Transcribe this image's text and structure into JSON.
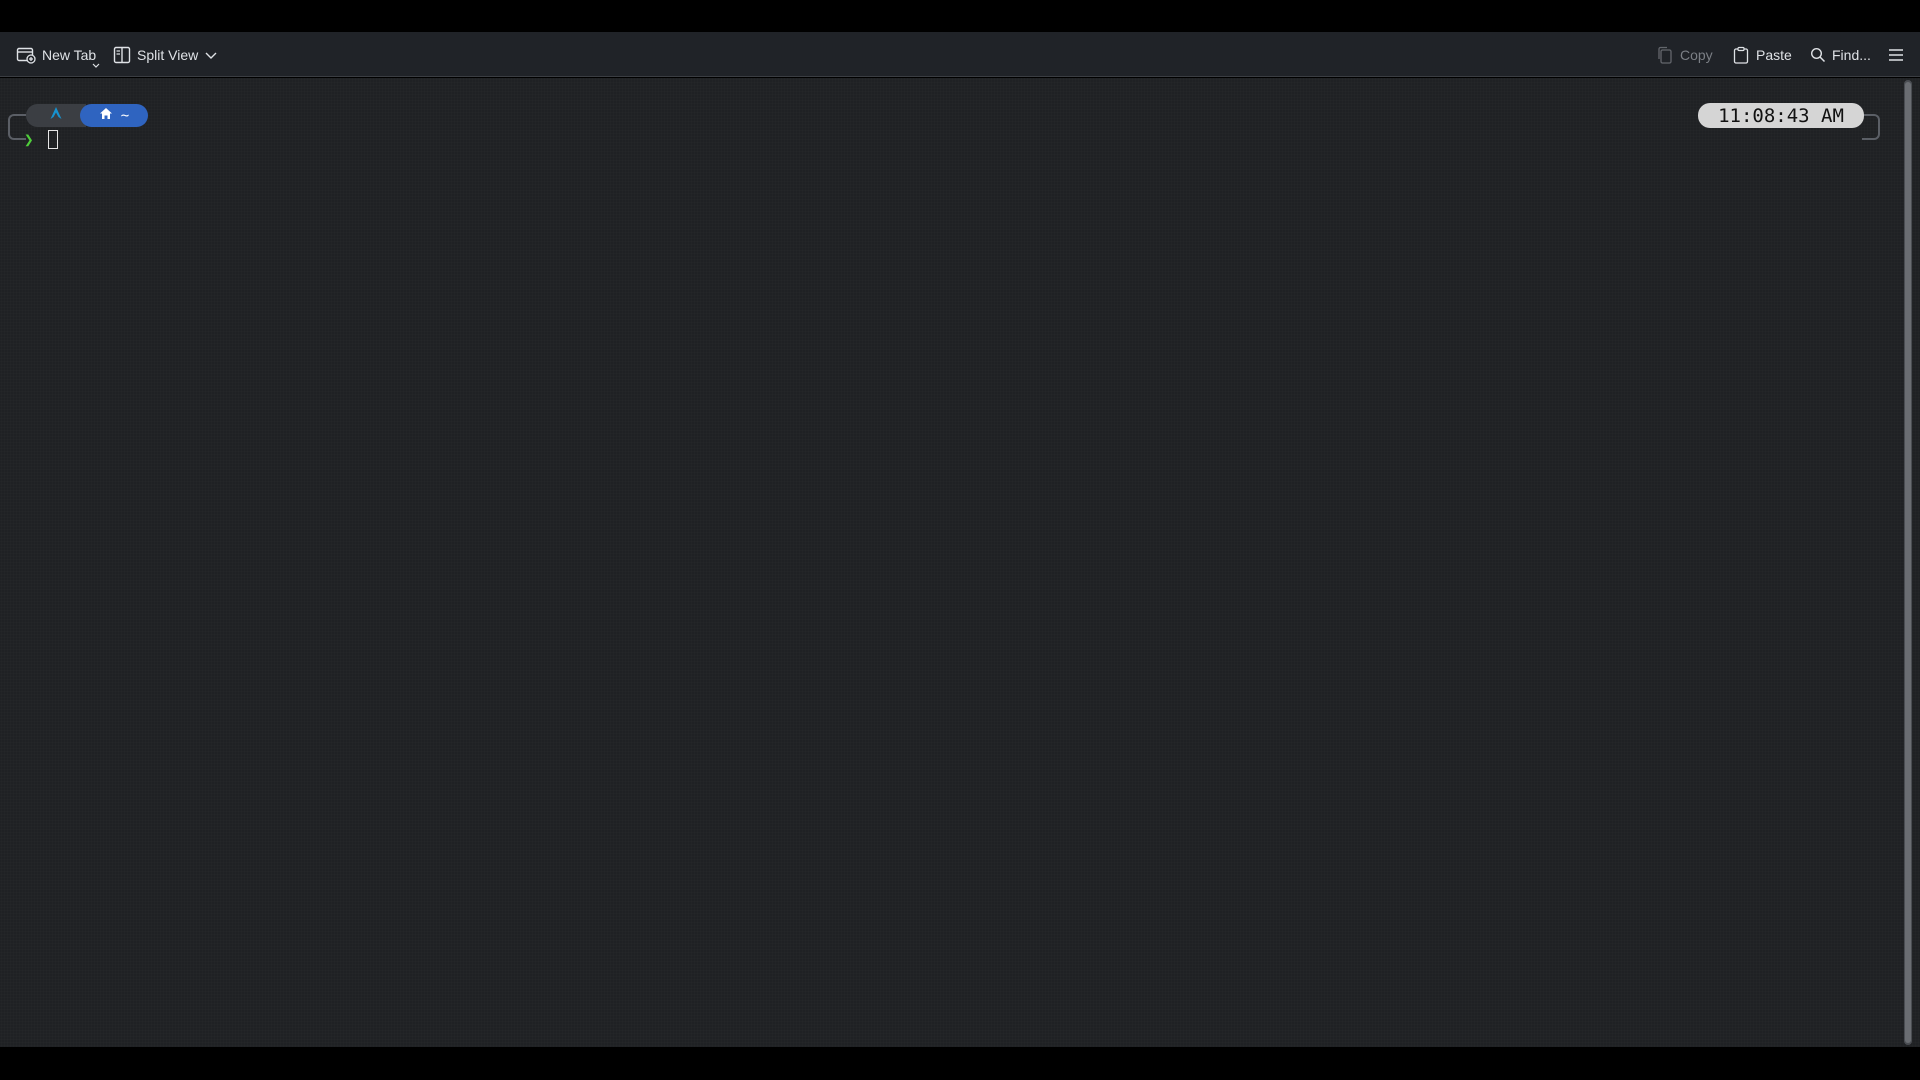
{
  "toolbar": {
    "new_tab_label": "New Tab",
    "split_view_label": "Split View",
    "copy_label": "Copy",
    "paste_label": "Paste",
    "find_label": "Find..."
  },
  "icons": {
    "new_tab": "new-tab-icon",
    "split_view": "split-view-icon",
    "copy": "copy-icon",
    "paste": "paste-icon",
    "find": "search-icon",
    "menu": "hamburger-menu-icon",
    "os_logo": "arch-linux-icon",
    "home": "home-icon"
  },
  "prompt": {
    "directory": "~",
    "prompt_symbol": "❯",
    "time": "11:08:43 AM"
  },
  "colors": {
    "toolbar_bg": "#202328",
    "terminal_bg": "#1f2124",
    "dir_segment": "#2f64c0",
    "os_segment": "#3b3e43",
    "os_logo": "#1793d1",
    "prompt_symbol": "#4fcf3a",
    "clock_bg": "#d5d5d5"
  }
}
